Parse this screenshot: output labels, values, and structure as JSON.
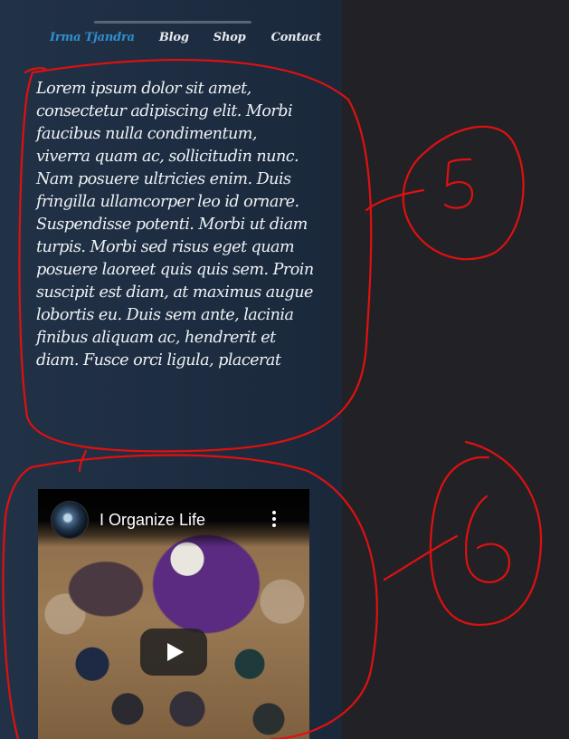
{
  "nav": {
    "brand": "Irma Tjandra",
    "items": [
      "Blog",
      "Shop",
      "Contact"
    ]
  },
  "content": {
    "paragraph": "Lorem ipsum dolor sit amet, consectetur adipiscing elit. Morbi faucibus nulla condimentum, viverra quam ac, sollicitudin nunc. Nam posuere ultricies enim. Duis fringilla ullamcorper leo id ornare. Suspendisse potenti. Morbi ut diam turpis. Morbi sed risus eget quam posuere laoreet quis quis sem. Proin suscipit est diam, at maximus augue lobortis eu. Duis sem ante, lacinia finibus aliquam ac, hendrerit et diam. Fusce orci ligula, placerat"
  },
  "video": {
    "title": "I Organize Life",
    "icons": [
      "channel-avatar",
      "more-options-icon",
      "play-icon"
    ]
  },
  "annotations": {
    "labels": [
      "5",
      "6"
    ],
    "color": "#e01010"
  },
  "colors": {
    "brand": "#2f8fd0",
    "page_bg": "#222226",
    "panel_bg": "#1f2d40"
  }
}
